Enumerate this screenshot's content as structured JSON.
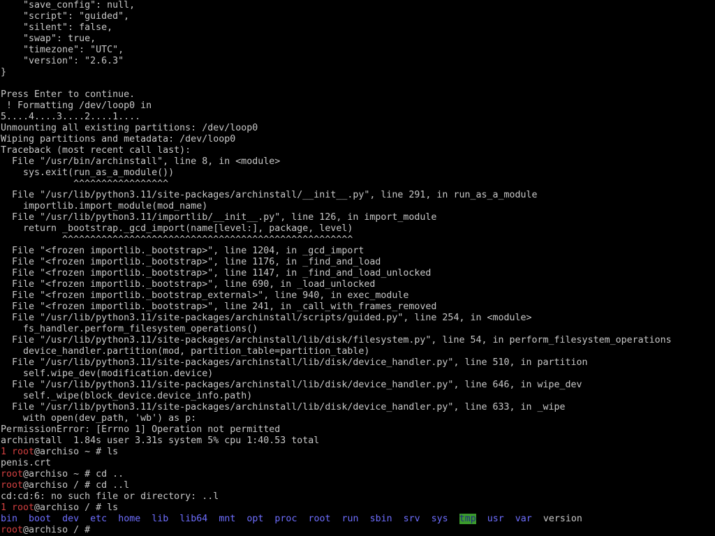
{
  "terminal": {
    "background": "#000000",
    "foreground": "#c8c8c8",
    "prompt_color": "#d24040",
    "dir_color": "#6e6eff",
    "tmp_bg": "#3a9a2c",
    "lines": [
      "    \"save_config\": null,",
      "    \"script\": \"guided\",",
      "    \"silent\": false,",
      "    \"swap\": true,",
      "    \"timezone\": \"UTC\",",
      "    \"version\": \"2.6.3\"",
      "}",
      "",
      "Press Enter to continue.",
      " ! Formatting /dev/loop0 in",
      "5....4....3....2....1....",
      "Unmounting all existing partitions: /dev/loop0",
      "Wiping partitions and metadata: /dev/loop0",
      "Traceback (most recent call last):",
      "  File \"/usr/bin/archinstall\", line 8, in <module>",
      "    sys.exit(run_as_a_module())",
      "             ^^^^^^^^^^^^^^^^^",
      "  File \"/usr/lib/python3.11/site-packages/archinstall/__init__.py\", line 291, in run_as_a_module",
      "    importlib.import_module(mod_name)",
      "  File \"/usr/lib/python3.11/importlib/__init__.py\", line 126, in import_module",
      "    return _bootstrap._gcd_import(name[level:], package, level)",
      "           ^^^^^^^^^^^^^^^^^^^^^^^^^^^^^^^^^^^^^^^^^^^^^^^^^^^^",
      "  File \"<frozen importlib._bootstrap>\", line 1204, in _gcd_import",
      "  File \"<frozen importlib._bootstrap>\", line 1176, in _find_and_load",
      "  File \"<frozen importlib._bootstrap>\", line 1147, in _find_and_load_unlocked",
      "  File \"<frozen importlib._bootstrap>\", line 690, in _load_unlocked",
      "  File \"<frozen importlib._bootstrap_external>\", line 940, in exec_module",
      "  File \"<frozen importlib._bootstrap>\", line 241, in _call_with_frames_removed",
      "  File \"/usr/lib/python3.11/site-packages/archinstall/scripts/guided.py\", line 254, in <module>",
      "    fs_handler.perform_filesystem_operations()",
      "  File \"/usr/lib/python3.11/site-packages/archinstall/lib/disk/filesystem.py\", line 54, in perform_filesystem_operations",
      "    device_handler.partition(mod, partition_table=partition_table)",
      "  File \"/usr/lib/python3.11/site-packages/archinstall/lib/disk/device_handler.py\", line 510, in partition",
      "    self.wipe_dev(modification.device)",
      "  File \"/usr/lib/python3.11/site-packages/archinstall/lib/disk/device_handler.py\", line 646, in wipe_dev",
      "    self._wipe(block_device.device_info.path)",
      "  File \"/usr/lib/python3.11/site-packages/archinstall/lib/disk/device_handler.py\", line 633, in _wipe",
      "    with open(dev_path, 'wb') as p:",
      "PermissionError: [Errno 1] Operation not permitted",
      "archinstall  1.84s user 3.31s system 5% cpu 1:40.53 total"
    ],
    "prompt_lines": [
      {
        "exit_code": "1 ",
        "user": "root",
        "host_path": "@archiso ~ # ",
        "cmd": "ls"
      },
      {
        "output": "penis.crt"
      },
      {
        "exit_code": "",
        "user": "root",
        "host_path": "@archiso ~ # ",
        "cmd": "cd .."
      },
      {
        "exit_code": "",
        "user": "root",
        "host_path": "@archiso / # ",
        "cmd": "cd ..l"
      },
      {
        "output": "cd:cd:6: no such file or directory: ..l"
      },
      {
        "exit_code": "1 ",
        "user": "root",
        "host_path": "@archiso / # ",
        "cmd": "ls"
      }
    ],
    "ls_entries": [
      {
        "name": "bin",
        "kind": "dir"
      },
      {
        "name": "boot",
        "kind": "dir"
      },
      {
        "name": "dev",
        "kind": "dir"
      },
      {
        "name": "etc",
        "kind": "dir"
      },
      {
        "name": "home",
        "kind": "dir"
      },
      {
        "name": "lib",
        "kind": "dir"
      },
      {
        "name": "lib64",
        "kind": "dir"
      },
      {
        "name": "mnt",
        "kind": "dir"
      },
      {
        "name": "opt",
        "kind": "dir"
      },
      {
        "name": "proc",
        "kind": "dir"
      },
      {
        "name": "root",
        "kind": "dir"
      },
      {
        "name": "run",
        "kind": "dir"
      },
      {
        "name": "sbin",
        "kind": "dir"
      },
      {
        "name": "srv",
        "kind": "dir"
      },
      {
        "name": "sys",
        "kind": "dir"
      },
      {
        "name": "tmp",
        "kind": "sticky"
      },
      {
        "name": "usr",
        "kind": "dir"
      },
      {
        "name": "var",
        "kind": "dir"
      },
      {
        "name": "version",
        "kind": "file"
      }
    ],
    "ls_paddings": [
      "",
      "  ",
      "  ",
      "  ",
      "  ",
      "  ",
      "  ",
      "  ",
      "  ",
      "  ",
      "  ",
      "  ",
      "  ",
      "  ",
      "  ",
      "  ",
      "  ",
      "  ",
      "  "
    ],
    "final_prompt": {
      "user": "root",
      "host_path": "@archiso / # ",
      "cmd": ""
    }
  }
}
